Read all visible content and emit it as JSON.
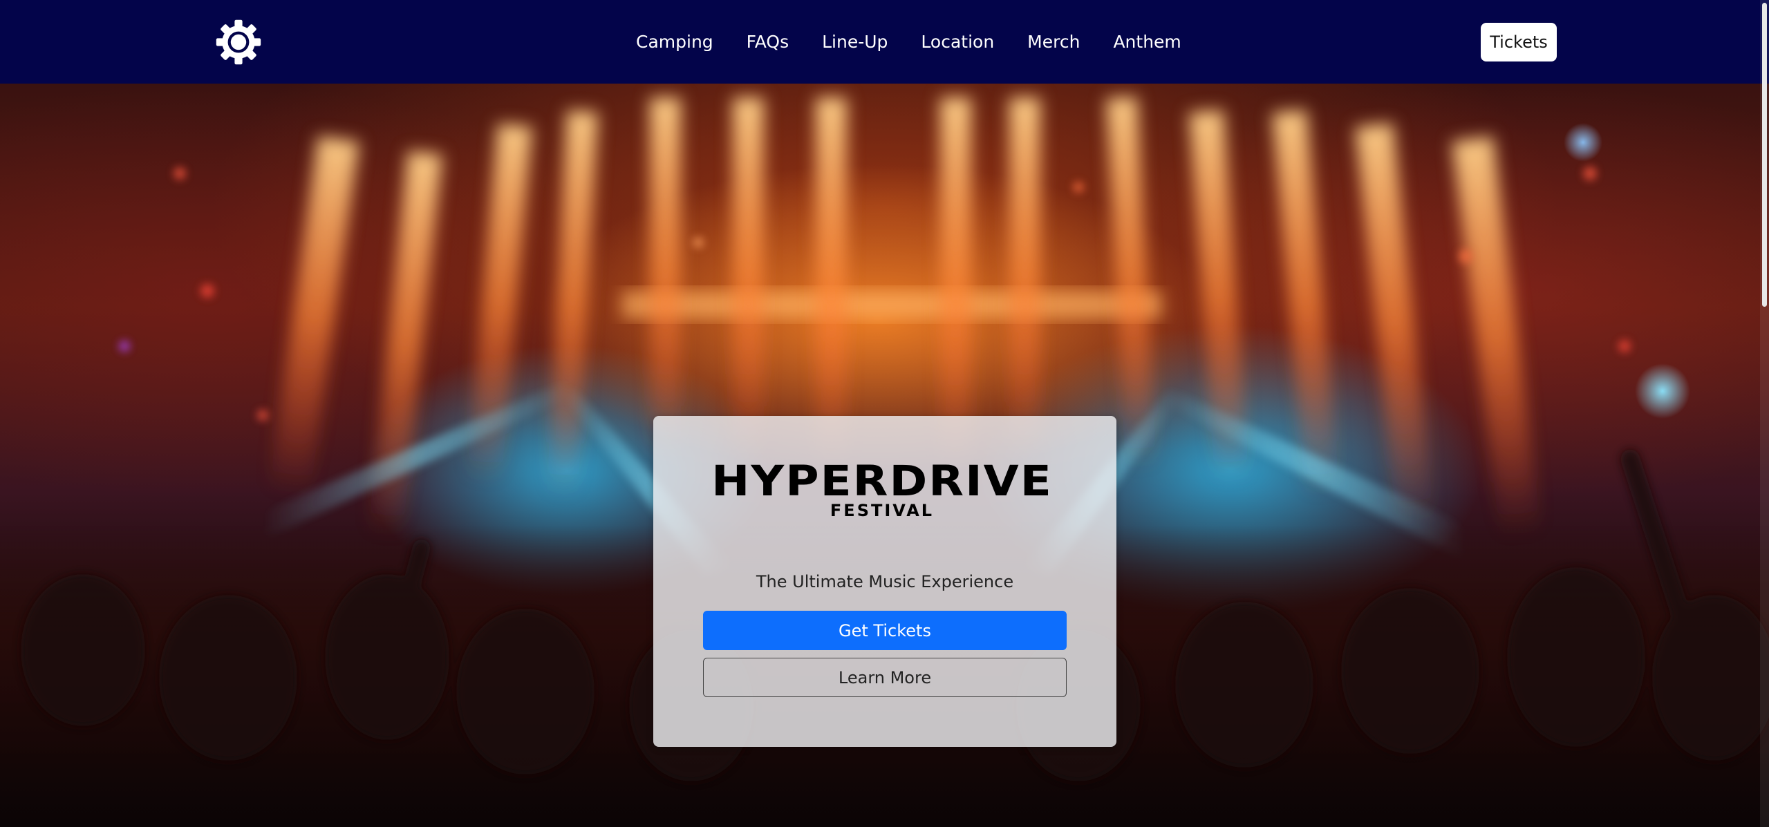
{
  "navbar": {
    "logo_icon": "gear-icon",
    "links": [
      "Camping",
      "FAQs",
      "Line-Up",
      "Location",
      "Merch",
      "Anthem"
    ],
    "tickets_label": "Tickets",
    "background": "#03044a"
  },
  "hero": {
    "brand_main": "HYPERDRIVE",
    "brand_sub": "FESTIVAL",
    "tagline": "The Ultimate Music Experience",
    "get_tickets_label": "Get Tickets",
    "learn_more_label": "Learn More",
    "primary_color": "#0d6efd"
  }
}
